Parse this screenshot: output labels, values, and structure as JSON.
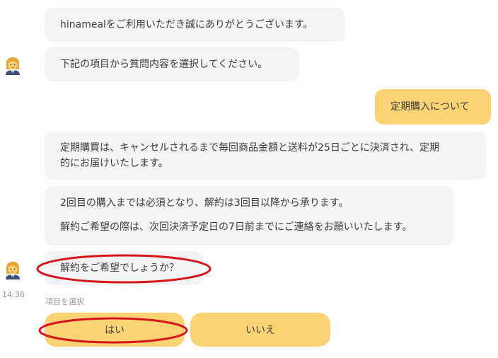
{
  "messages": {
    "m1": "hinamealをご利用いただき誠にありがとうございます。",
    "m2": "下記の項目から質問内容を選択してください。",
    "m3_user": "定期購入について",
    "m4_line1": "定期購買は、キャンセルされるまで毎回商品金額と送料が25日ごとに決済され、定期",
    "m4_line2": "的にお届けいたします。",
    "m5_p1": "2回目の購入までは必須となり、解約は3回目以降から承ります。",
    "m5_p2": "解約ご希望の際は、次回決済予定日の7日前までにご連絡をお願いいたします。",
    "m6": "解約をご希望でしょうか？"
  },
  "timestamp": "14:38",
  "select_hint": "項目を選択",
  "choices": {
    "yes": "はい",
    "no": "いいえ"
  },
  "colors": {
    "bot_bubble": "#f3f4f6",
    "user_bubble": "#fcd374",
    "annotation": "#d8141c"
  },
  "icons": {
    "avatar": "woman-office-worker-emoji"
  }
}
